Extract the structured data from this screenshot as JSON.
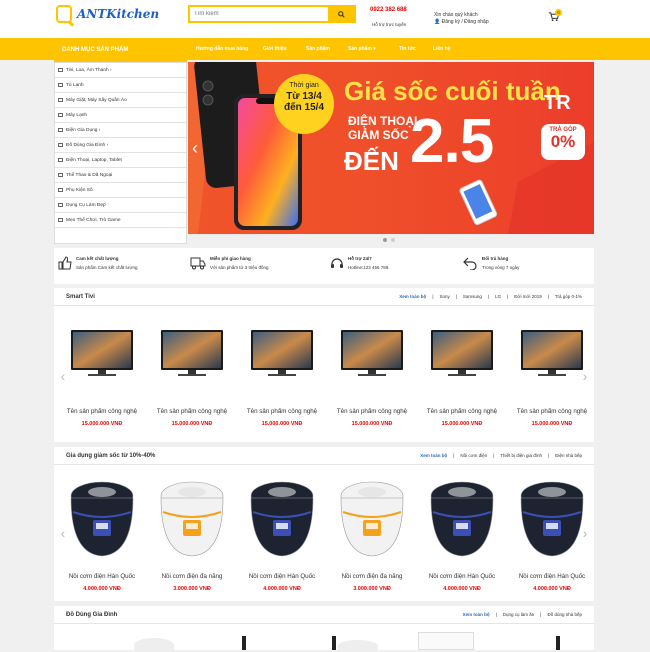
{
  "header": {
    "logo_text": "ANTKitchen",
    "search_placeholder": "Tìm kiếm",
    "hotline": "0922 382 688",
    "hotline_sub": "Hỗ trợ trực tuyến",
    "greeting": "Xin chào quý khách",
    "auth": "Đăng ký / Đăng nhập",
    "cart_count": "0"
  },
  "nav": {
    "category_header": "DANH MỤC SẢN PHẨM",
    "items": [
      "Hướng dẫn mua hàng",
      "Giới thiệu",
      "Sản phẩm",
      "Tin tức",
      "Liên hệ"
    ],
    "dropdown_item": "Sản phẩm ▾"
  },
  "categories": [
    {
      "label": "Tivi, Loa, Âm Thanh",
      "arrow": true
    },
    {
      "label": "Tủ Lạnh",
      "arrow": false
    },
    {
      "label": "Máy Giặt, Máy Sấy Quần Áo",
      "arrow": false
    },
    {
      "label": "Máy Lạnh",
      "arrow": false
    },
    {
      "label": "Điện Gia Dụng",
      "arrow": true
    },
    {
      "label": "Đồ Dùng Gia Đình",
      "arrow": true
    },
    {
      "label": "Điện Thoại, Laptop, Tablet",
      "arrow": false
    },
    {
      "label": "Thể Thao & Dã Ngoại",
      "arrow": false
    },
    {
      "label": "Phụ Kiện Số",
      "arrow": false
    },
    {
      "label": "Dụng Cụ Làm Đẹp",
      "arrow": false
    },
    {
      "label": "Mẹo Thể Chơi, Trò Game",
      "arrow": false
    }
  ],
  "banner": {
    "badge_line1": "Thời gian",
    "badge_line2": "Từ 13/4",
    "badge_line3": "đến 15/4",
    "headline": "Giá sốc cuối tuần",
    "sub1": "ĐIỆN THOẠI",
    "sub2": "GIẢM SỐC",
    "den": "ĐẾN",
    "amount": "2.5",
    "unit": "TR",
    "installment_label": "TRẢ GÓP",
    "installment_value": "0%"
  },
  "services": [
    {
      "icon": "thumbs-up-icon",
      "title": "Cam kết chất lượng",
      "sub": "Sản phẩm Cam kết chất lượng"
    },
    {
      "icon": "truck-icon",
      "title": "Miễn phí giao hàng",
      "sub": "Với sản phẩm từ 3 triệu đồng"
    },
    {
      "icon": "headset-icon",
      "title": "Hỗ trợ 24/7",
      "sub": "Hotline:123 456 789."
    },
    {
      "icon": "return-icon",
      "title": "Đổi trả hàng",
      "sub": "Trong vòng 7 ngày"
    }
  ],
  "sections": [
    {
      "title": "Smart Tivi",
      "tabs": [
        "Xem toàn bộ",
        "Sony",
        "Samsung",
        "LG",
        "Đời mới 2019",
        "Trả góp 0-1%"
      ],
      "product_type": "tv",
      "products": [
        {
          "name": "Tên sản phẩm công nghệ",
          "price": "15.000.000 VNĐ"
        },
        {
          "name": "Tên sản phẩm công nghệ",
          "price": "15.000.000 VNĐ"
        },
        {
          "name": "Tên sản phẩm công nghệ",
          "price": "15.000.000 VNĐ"
        },
        {
          "name": "Tên sản phẩm công nghệ",
          "price": "15.000.000 VNĐ"
        },
        {
          "name": "Tên sản phẩm công nghệ",
          "price": "15.000.000 VNĐ"
        },
        {
          "name": "Tên sản phẩm công nghệ",
          "price": "15.000.000 VNĐ"
        }
      ]
    },
    {
      "title": "Gia dụng giảm sốc từ 10%-40%",
      "tabs": [
        "Xem toàn bộ",
        "Nồi cơm điện",
        "Thiết bị điện gia đình",
        "Điện nhà bếp"
      ],
      "product_type": "cooker",
      "products": [
        {
          "name": "Nồi cơm điện Hàn Quốc",
          "price": "4.000.000 VNĐ",
          "variant": "dark"
        },
        {
          "name": "Nồi cơm điện đa năng",
          "price": "3.000.000 VNĐ",
          "variant": "light"
        },
        {
          "name": "Nồi cơm điện Hàn Quốc",
          "price": "4.000.000 VNĐ",
          "variant": "dark"
        },
        {
          "name": "Nồi cơm điện đa năng",
          "price": "3.000.000 VNĐ",
          "variant": "light"
        },
        {
          "name": "Nồi cơm điện Hàn Quốc",
          "price": "4.000.000 VNĐ",
          "variant": "dark"
        },
        {
          "name": "Nồi cơm điện Hàn Quốc",
          "price": "4.000.000 VNĐ",
          "variant": "dark"
        }
      ]
    },
    {
      "title": "Đồ Dùng Gia Đình",
      "tabs": [
        "Xem toàn bộ",
        "Dụng cụ làm ăn",
        "Đồ dùng nhà bếp"
      ]
    }
  ],
  "colors": {
    "accent": "#ffc400",
    "price": "#e00000",
    "link": "#2b6ab5",
    "banner": "#f0542a"
  }
}
